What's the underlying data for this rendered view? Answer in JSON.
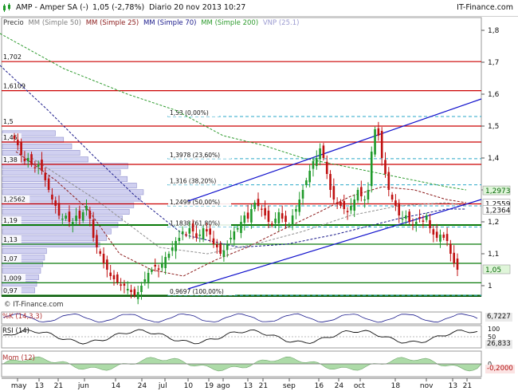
{
  "header": {
    "title": "AMP - Amper SA (-)",
    "value": "1,05 (-2,78%)",
    "period": "Diario  20 nov 2013 10:27",
    "brand": "IT-Finance.com"
  },
  "legend": {
    "precio": "Precio",
    "mm50": "MM (Simple 50)",
    "mm25": "MM (Simple 25)",
    "mm70": "MM (Simple 70)",
    "mm200": "MM (Simple 200)",
    "vnp": "VNP (25.1)"
  },
  "colors": {
    "mm50": "#909090",
    "mm25": "#8b1a1a",
    "mm70": "#1a1a8b",
    "mm200": "#2e9b2e",
    "vnp": "#9a9ad0",
    "up": "#1f9a2a",
    "down": "#c01010",
    "resistance": "#cc0000",
    "support": "#0a7a0a",
    "trend": "#1010cc",
    "fib": "#2aa7c8"
  },
  "price_axis": [
    "1,8",
    "1,7",
    "1,6",
    "1,5",
    "1,4",
    "1,3",
    "1,2",
    "1,1",
    "1"
  ],
  "left_levels": [
    "1,702",
    "1,6109",
    "1,5",
    "1,45",
    "1,38",
    "1,2562",
    "1,19",
    "1,13",
    "1,07",
    "1,009",
    "0,97"
  ],
  "fib_labels": [
    "1,53 (0,00%)",
    "1,3978 (23,60%)",
    "1,316 (38,20%)",
    "1,2499 (50,00%)",
    "1,1838 (61,80%)",
    "0,9697 (100,00%)"
  ],
  "price_badges": {
    "mm200": "1,2973",
    "mm25": "1,2559",
    "mm70": "1,2364",
    "last": "1,05"
  },
  "watermark": "© IT-Finance.com",
  "panels": {
    "stoch": {
      "title": "%K (14,3,3)",
      "badge": "6,7227"
    },
    "rsi": {
      "title": "RSI (14)",
      "axis_top": "100",
      "axis_mid": "50",
      "badge": "26,833"
    },
    "mom": {
      "title": "Mom (12)",
      "axis_zero": "0",
      "badge": "-0,2000"
    }
  },
  "x_axis": [
    "may",
    "13",
    "21",
    "jun",
    "14",
    "24",
    "jul",
    "10",
    "19",
    "ago",
    "13",
    "21",
    "sep",
    "16",
    "24",
    "oct",
    "18",
    "nov",
    "13",
    "21"
  ],
  "chart_data": {
    "type": "candlestick",
    "symbol": "AMP - Amper SA",
    "timeframe": "Diario",
    "last_price": 1.05,
    "change_pct": -2.78,
    "ylim": [
      0.96,
      1.82
    ],
    "close_path": [
      1.46,
      1.44,
      1.41,
      1.39,
      1.4,
      1.38,
      1.37,
      1.38,
      1.36,
      1.33,
      1.3,
      1.27,
      1.25,
      1.22,
      1.21,
      1.22,
      1.2,
      1.2,
      1.22,
      1.21,
      1.23,
      1.25,
      1.21,
      1.15,
      1.12,
      1.1,
      1.07,
      1.05,
      1.03,
      1.02,
      1.01,
      1.0,
      1.0,
      0.99,
      0.98,
      0.97,
      0.98,
      1.0,
      1.02,
      1.04,
      1.05,
      1.06,
      1.05,
      1.07,
      1.09,
      1.1,
      1.12,
      1.14,
      1.15,
      1.17,
      1.16,
      1.18,
      1.17,
      1.15,
      1.16,
      1.18,
      1.17,
      1.16,
      1.13,
      1.12,
      1.1,
      1.11,
      1.13,
      1.15,
      1.17,
      1.18,
      1.2,
      1.22,
      1.21,
      1.24,
      1.26,
      1.25,
      1.24,
      1.22,
      1.2,
      1.19,
      1.21,
      1.23,
      1.21,
      1.2,
      1.19,
      1.22,
      1.24,
      1.27,
      1.3,
      1.33,
      1.36,
      1.39,
      1.4,
      1.43,
      1.4,
      1.35,
      1.3,
      1.27,
      1.26,
      1.25,
      1.24,
      1.23,
      1.25,
      1.27,
      1.3,
      1.28,
      1.27,
      1.3,
      1.42,
      1.49,
      1.47,
      1.4,
      1.35,
      1.3,
      1.27,
      1.25,
      1.22,
      1.21,
      1.22,
      1.2,
      1.19,
      1.2,
      1.21,
      1.2,
      1.22,
      1.18,
      1.16,
      1.15,
      1.16,
      1.15,
      1.14,
      1.1,
      1.07,
      1.05
    ],
    "horizontal_levels": {
      "resistance": [
        1.702,
        1.6109,
        1.5,
        1.45,
        1.38,
        1.2562
      ],
      "support": [
        1.19,
        1.13,
        1.07,
        1.009,
        0.97
      ]
    },
    "fibonacci": [
      {
        "level": 1.53,
        "pct": "0,00%"
      },
      {
        "level": 1.3978,
        "pct": "23,60%"
      },
      {
        "level": 1.316,
        "pct": "38,20%"
      },
      {
        "level": 1.2499,
        "pct": "50,00%"
      },
      {
        "level": 1.1838,
        "pct": "61,80%"
      },
      {
        "level": 0.9697,
        "pct": "100,00%"
      }
    ],
    "moving_averages": [
      {
        "name": "MM (Simple 25)",
        "last": 1.2559
      },
      {
        "name": "MM (Simple 70)",
        "last": 1.2364
      },
      {
        "name": "MM (Simple 200)",
        "last": 1.2973
      }
    ],
    "indicators": [
      {
        "name": "%K (14,3,3)",
        "last": 6.7227
      },
      {
        "name": "RSI (14)",
        "last": 26.833
      },
      {
        "name": "Mom (12)",
        "last": -0.2
      }
    ]
  }
}
